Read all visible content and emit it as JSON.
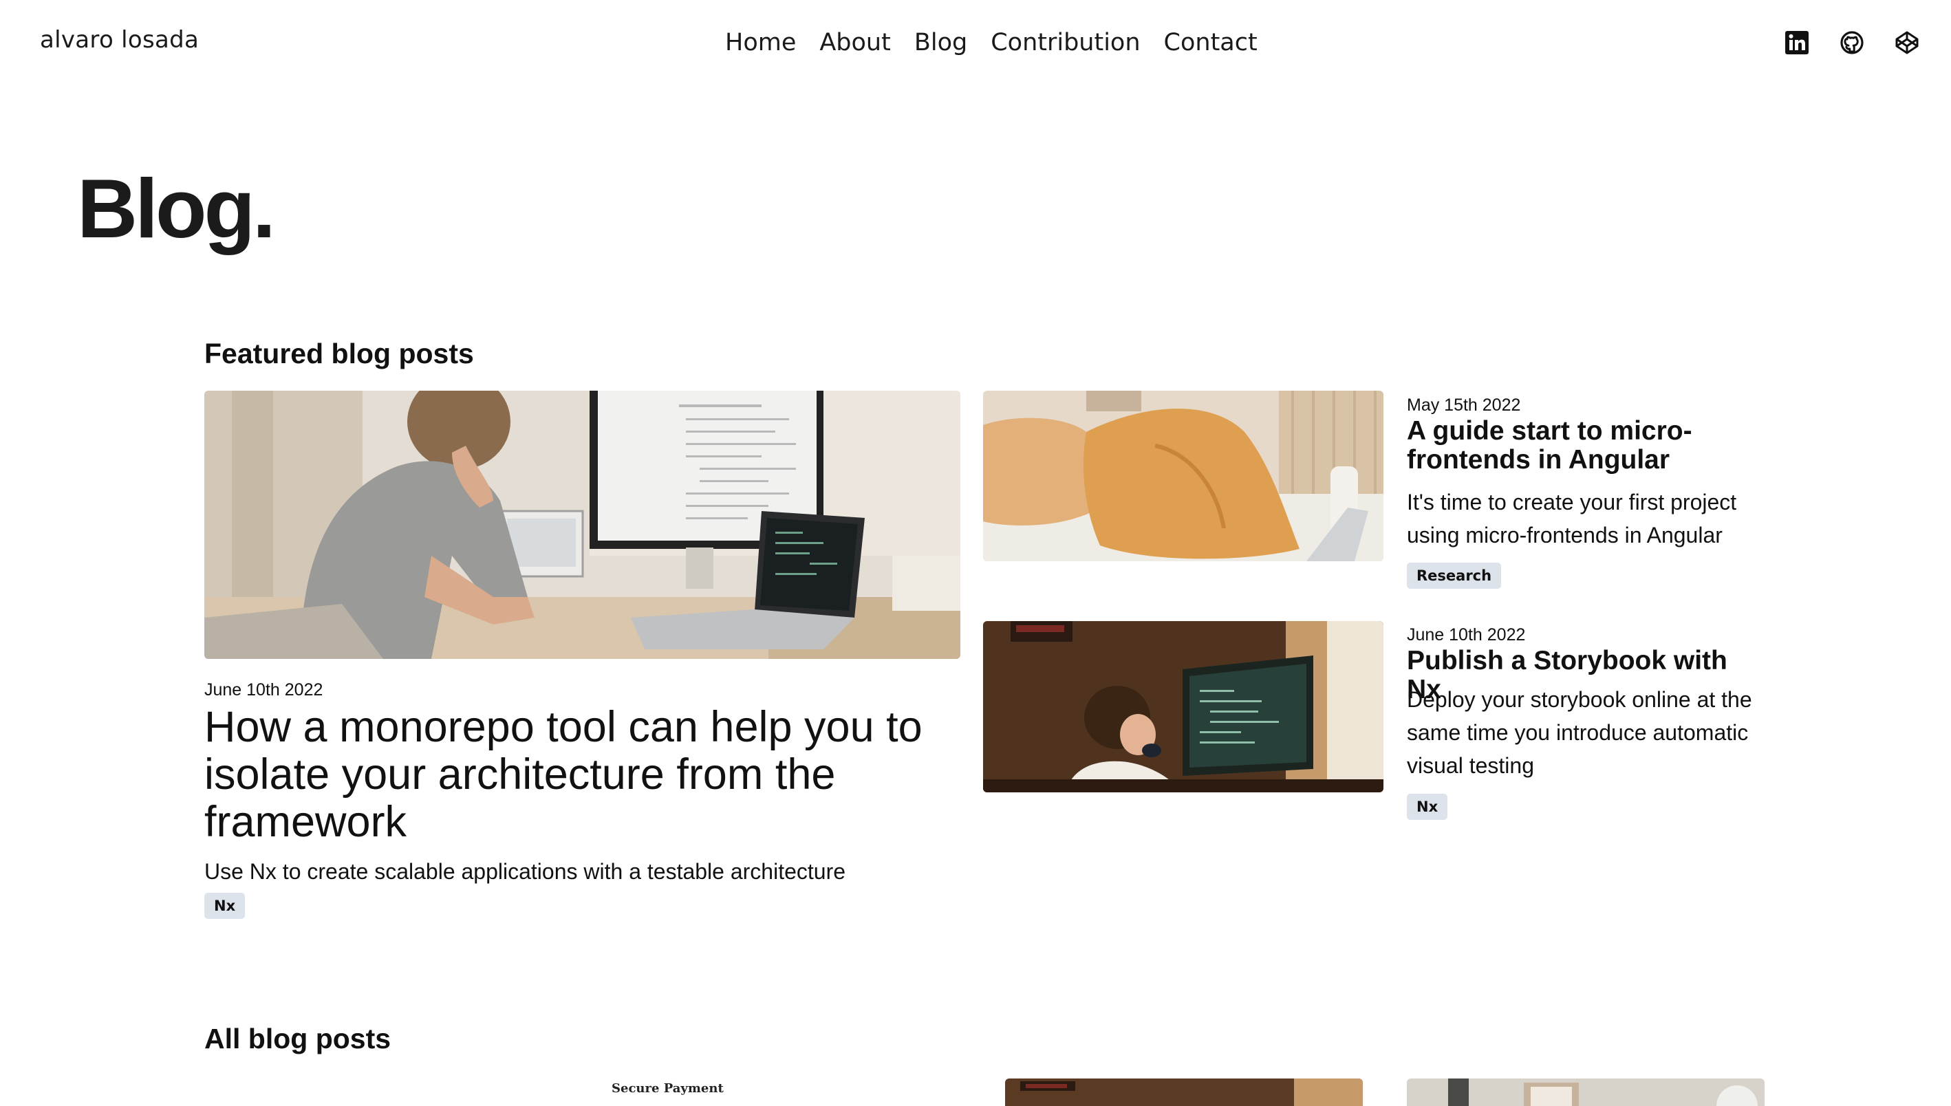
{
  "header": {
    "brand": "alvaro losada",
    "nav": [
      "Home",
      "About",
      "Blog",
      "Contribution",
      "Contact"
    ],
    "social_icons": [
      "linkedin-icon",
      "github-icon",
      "codepen-icon"
    ]
  },
  "page": {
    "title": "Blog."
  },
  "featured": {
    "heading": "Featured blog posts",
    "main": {
      "date": "June 10th 2022",
      "title": "How a monorepo tool can help you to isolate your architecture from the framework",
      "excerpt": "Use Nx to create scalable applications with a testable architecture",
      "tag": "Nx",
      "image": "developer-at-desk-photo"
    },
    "side": [
      {
        "date": "May 15th 2022",
        "title": "A guide start to micro-frontends in Angular",
        "excerpt": "It's time to create your first project using micro-frontends in Angular",
        "tag": "Research",
        "image": "orange-pillows-photo"
      },
      {
        "date": "June 10th 2022",
        "title": "Publish a Storybook with Nx",
        "excerpt": "Deploy your storybook online at the same time you introduce automatic visual testing",
        "tag": "Nx",
        "image": "child-at-computer-photo"
      }
    ]
  },
  "all_posts": {
    "heading": "All blog posts",
    "peek_text": "Secure Payment"
  },
  "colors": {
    "text": "#111111",
    "tag_bg": "#dde3ea",
    "background": "#ffffff"
  }
}
